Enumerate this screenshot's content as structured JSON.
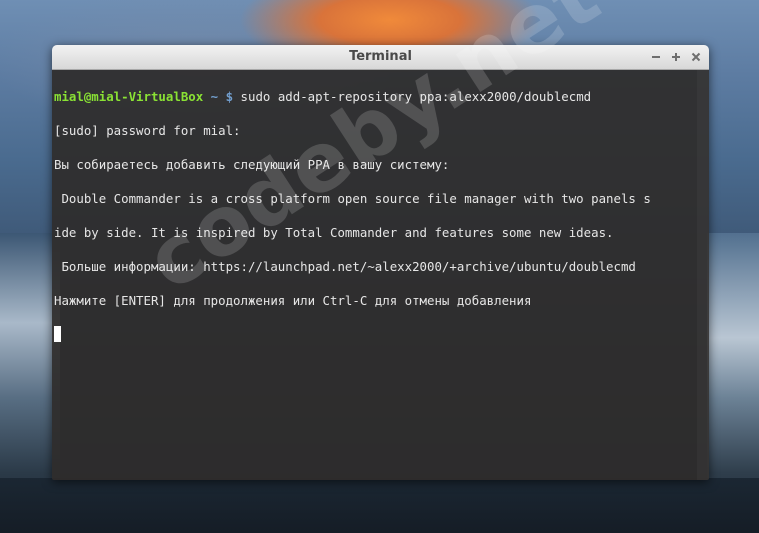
{
  "window": {
    "title": "Terminal",
    "controls": {
      "minimize": "−",
      "maximize": "+",
      "close": "×"
    }
  },
  "terminal": {
    "prompt_user_host": "mial@mial-VirtualBox",
    "prompt_path": "~ $",
    "command": " sudo add-apt-repository ppa:alexx2000/doublecmd",
    "lines": [
      "[sudo] password for mial:",
      "Вы собираетесь добавить следующий PPA в вашу систему:",
      " Double Commander is a cross platform open source file manager with two panels s",
      "ide by side. It is inspired by Total Commander and features some new ideas.",
      " Больше информации: https://launchpad.net/~alexx2000/+archive/ubuntu/doublecmd",
      "Нажмите [ENTER] для продолжения или Ctrl-C для отмены добавления"
    ]
  },
  "watermark": "codeby.net",
  "colors": {
    "prompt_user": "#8ae234",
    "prompt_path": "#729fcf",
    "terminal_bg": "#2e2c2b",
    "text": "#e6e6e6"
  }
}
